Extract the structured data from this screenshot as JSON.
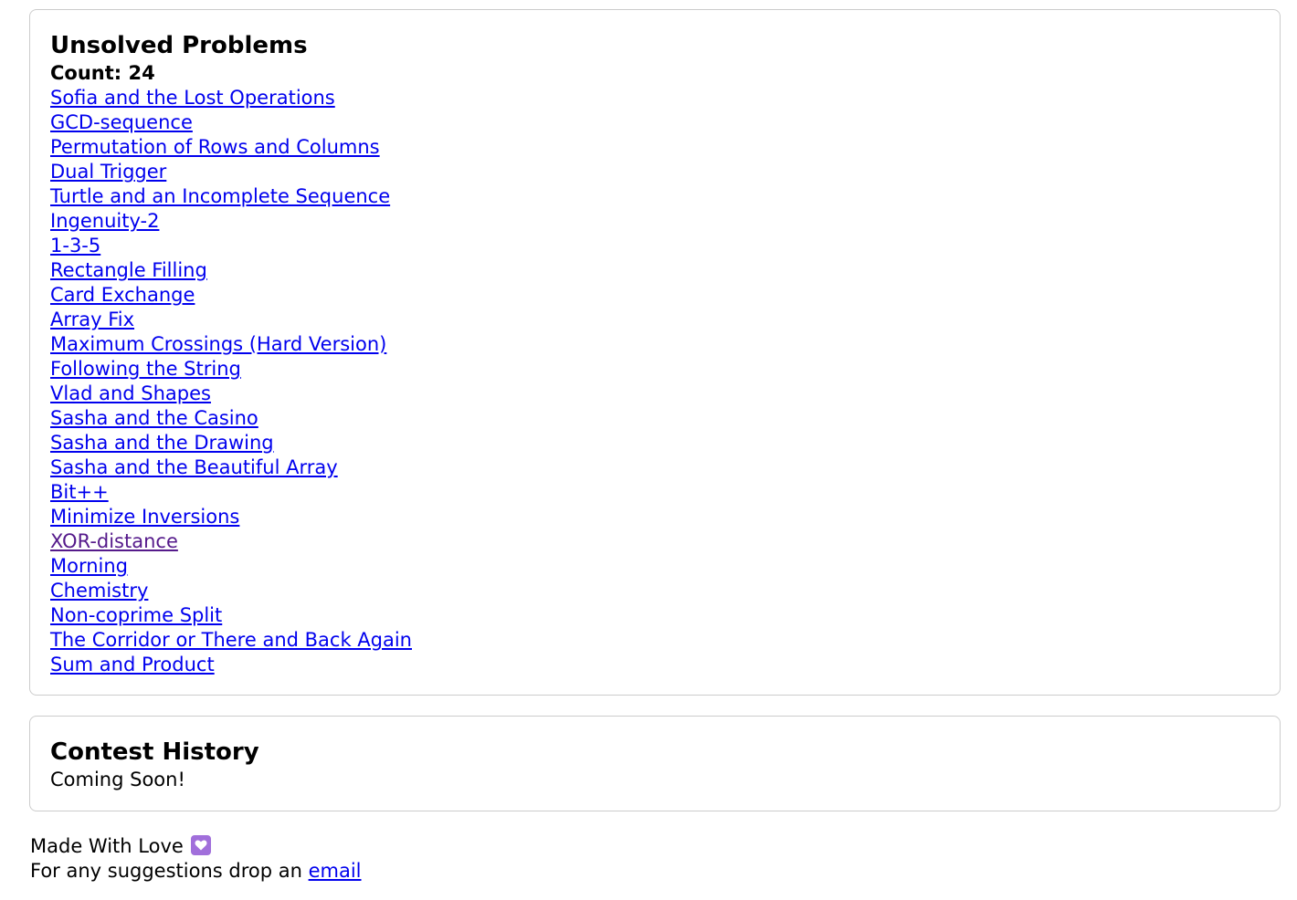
{
  "unsolved": {
    "title": "Unsolved Problems",
    "count_label": "Count: 24",
    "problems": [
      {
        "title": "Sofia and the Lost Operations",
        "visited": false
      },
      {
        "title": "GCD-sequence",
        "visited": false
      },
      {
        "title": "Permutation of Rows and Columns",
        "visited": false
      },
      {
        "title": "Dual Trigger",
        "visited": false
      },
      {
        "title": "Turtle and an Incomplete Sequence",
        "visited": false
      },
      {
        "title": "Ingenuity-2",
        "visited": false
      },
      {
        "title": "1-3-5",
        "visited": false
      },
      {
        "title": "Rectangle Filling",
        "visited": false
      },
      {
        "title": "Card Exchange",
        "visited": false
      },
      {
        "title": "Array Fix",
        "visited": false
      },
      {
        "title": "Maximum Crossings (Hard Version)",
        "visited": false
      },
      {
        "title": "Following the String",
        "visited": false
      },
      {
        "title": "Vlad and Shapes",
        "visited": false
      },
      {
        "title": "Sasha and the Casino",
        "visited": false
      },
      {
        "title": "Sasha and the Drawing",
        "visited": false
      },
      {
        "title": "Sasha and the Beautiful Array",
        "visited": false
      },
      {
        "title": "Bit++",
        "visited": false
      },
      {
        "title": "Minimize Inversions",
        "visited": false
      },
      {
        "title": "XOR-distance",
        "visited": true
      },
      {
        "title": "Morning",
        "visited": false
      },
      {
        "title": "Chemistry",
        "visited": false
      },
      {
        "title": "Non-coprime Split",
        "visited": false
      },
      {
        "title": "The Corridor or There and Back Again",
        "visited": false
      },
      {
        "title": "Sum and Product",
        "visited": false
      }
    ]
  },
  "contest_history": {
    "title": "Contest History",
    "message": "Coming Soon!"
  },
  "footer": {
    "made_with": "Made With Love",
    "heart_icon": "purple-heart-icon",
    "suggestion_text": "For any suggestions drop an ",
    "email_link": "email"
  },
  "colors": {
    "link": "#0000ee",
    "visited_link": "#551a8b",
    "card_border": "#cccccc",
    "heart_badge": "#a16fdb"
  }
}
